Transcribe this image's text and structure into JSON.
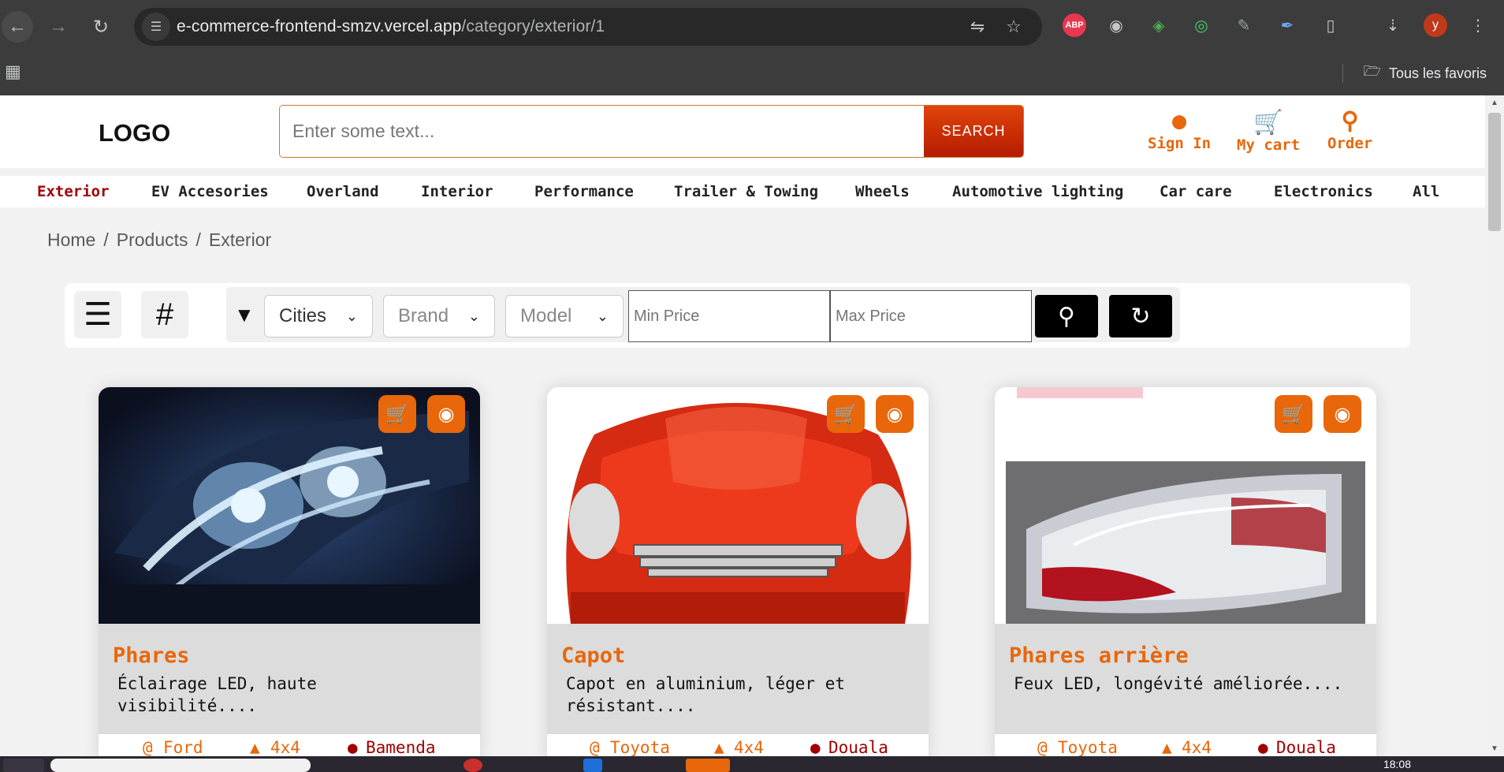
{
  "browser": {
    "url_host": "e-commerce-frontend-smzv.vercel.app",
    "url_path": "/category/exterior/1",
    "bookmarks_label": "Tous les favoris",
    "avatar_letter": "y",
    "abp_label": "ABP",
    "icons": [
      "back-icon",
      "forward-icon",
      "reload-icon",
      "site-info-icon",
      "translate-icon",
      "star-icon",
      "extensions-icon",
      "download-icon",
      "menu-icon",
      "apps-grid-icon",
      "folder-icon"
    ]
  },
  "header": {
    "logo": "LOGO",
    "search_placeholder": "Enter some text...",
    "search_button": "SEARCH",
    "sign_in": "Sign In",
    "cart": "My cart",
    "order": "Order"
  },
  "categories": [
    {
      "label": "Exterior",
      "active": true
    },
    {
      "label": "EV Accesories"
    },
    {
      "label": "Overland"
    },
    {
      "label": "Interior"
    },
    {
      "label": "Performance"
    },
    {
      "label": "Trailer & Towing"
    },
    {
      "label": "Wheels"
    },
    {
      "label": "Automotive lighting"
    },
    {
      "label": "Car care"
    },
    {
      "label": "Electronics"
    },
    {
      "label": "All"
    }
  ],
  "breadcrumb": [
    "Home",
    "Products",
    "Exterior"
  ],
  "filters": {
    "cities": "Cities",
    "brand": "Brand",
    "model": "Model",
    "min_price_placeholder": "Min Price",
    "max_price_placeholder": "Max Price"
  },
  "products": [
    {
      "title": "Phares",
      "desc": "Éclairage LED, haute visibilité....",
      "brand": "Ford",
      "type": "4x4",
      "city": "Bamenda"
    },
    {
      "title": "Capot",
      "desc": "Capot en aluminium, léger et résistant....",
      "brand": "Toyota",
      "type": "4x4",
      "city": "Douala"
    },
    {
      "title": "Phares arrière",
      "desc": "Feux LED, longévité améliorée....",
      "brand": "Toyota",
      "type": "4x4",
      "city": "Douala"
    }
  ],
  "taskbar": {
    "clock": "18:08"
  },
  "colors": {
    "accent": "#e8670a",
    "active_category": "#a00000",
    "search_button": "#c62a00"
  }
}
